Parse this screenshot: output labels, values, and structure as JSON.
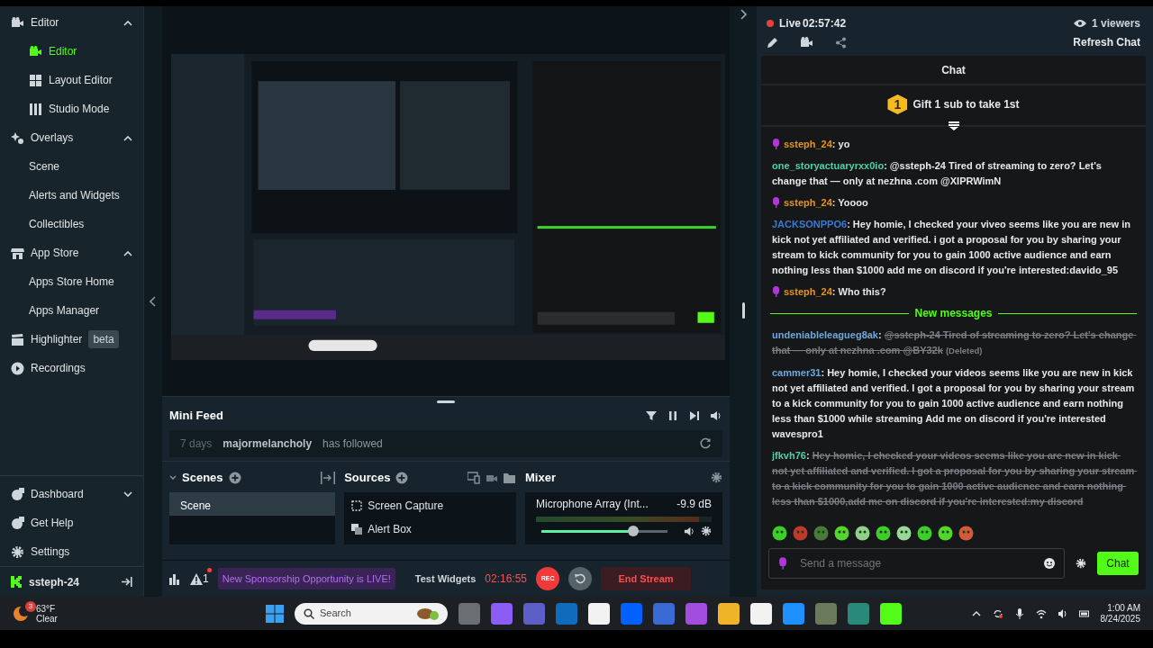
{
  "sidebar": {
    "sections": [
      {
        "label": "Editor",
        "expanded": true,
        "children": [
          {
            "label": "Editor",
            "selected": true
          },
          {
            "label": "Layout Editor",
            "selected": false
          },
          {
            "label": "Studio Mode",
            "selected": false
          }
        ]
      },
      {
        "label": "Overlays",
        "expanded": true,
        "children": [
          {
            "label": "Scene",
            "selected": false
          },
          {
            "label": "Alerts and Widgets",
            "selected": false
          },
          {
            "label": "Collectibles",
            "selected": false
          }
        ]
      },
      {
        "label": "App Store",
        "expanded": true,
        "children": [
          {
            "label": "Apps Store Home",
            "selected": false
          },
          {
            "label": "Apps Manager",
            "selected": false
          }
        ]
      },
      {
        "label": "Highlighter",
        "badge": "beta"
      },
      {
        "label": "Recordings"
      }
    ],
    "bottom": [
      {
        "label": "Dashboard",
        "expanded": false
      },
      {
        "label": "Get Help"
      },
      {
        "label": "Settings"
      }
    ],
    "user": {
      "name": "ssteph-24"
    }
  },
  "mini_feed": {
    "title": "Mini Feed",
    "events": [
      {
        "time": "7 days",
        "user": "majormelancholy",
        "action": "has followed"
      }
    ]
  },
  "scenes": {
    "title": "Scenes",
    "items": [
      {
        "label": "Scene",
        "selected": true
      }
    ]
  },
  "sources": {
    "title": "Sources",
    "items": [
      {
        "label": "Screen Capture"
      },
      {
        "label": "Alert Box"
      }
    ]
  },
  "mixer": {
    "title": "Mixer",
    "channels": [
      {
        "name": "Microphone Array (Int...",
        "reading": "-9.9 dB",
        "meter": {
          "level": 0.93
        },
        "level": 0.73
      }
    ]
  },
  "footer": {
    "alerts": "1",
    "sponsorship": "New Sponsorship Opportunity is LIVE!",
    "test_widgets": "Test Widgets",
    "timer": "02:16:55",
    "rec": "REC",
    "end_stream": "End Stream"
  },
  "stream": {
    "status": "Live",
    "time": "02:57:42",
    "viewers": "1 viewers",
    "refresh": "Refresh Chat"
  },
  "chat": {
    "title": "Chat",
    "leaderboard": {
      "rank": "1",
      "text": "Gift 1 sub to take 1st"
    },
    "messages": [
      {
        "user": "ssteph_24",
        "color": "#e8941c",
        "broadcaster": true,
        "text": ": yo",
        "deleted": false
      },
      {
        "user": "one_storyactuaryrxx0io",
        "color": "#4fd1a5",
        "broadcaster": false,
        "text": ": @ssteph-24 Tired of streaming to zero? Let's change that — only at nezhna .com @XIPRWimN",
        "deleted": false
      },
      {
        "user": "ssteph_24",
        "color": "#e8941c",
        "broadcaster": true,
        "text": ": Yoooo",
        "deleted": false
      },
      {
        "user": "JACKSONPPO6",
        "color": "#3a7bd5",
        "broadcaster": false,
        "text": ": Hey homie, I checked your viveo seems like you are new in kick not yet affiliated and verified. i got a proposal for you by sharing your stream to kick community for you to gain 1000 active audience and earn nothing less than $1000 add me on discord if you're interested:davido_95",
        "deleted": false
      },
      {
        "user": "ssteph_24",
        "color": "#e8941c",
        "broadcaster": true,
        "text": ": Who this?",
        "deleted": false
      },
      {
        "kind": "divider",
        "text": "New messages"
      },
      {
        "user": "undeniableleagueg8ak",
        "color": "#6fa8dc",
        "broadcaster": false,
        "separator": ": ",
        "text": "@ssteph-24 Tired of streaming to zero? Let's change that — only at nezhna .com @BY32k",
        "deleted": true,
        "note": "(Deleted)"
      },
      {
        "user": "cammer31",
        "color": "#6fa8dc",
        "broadcaster": false,
        "text": ": Hey homie, I checked your videos seems like you are new in kick not yet affiliated and verified. I got a proposal for you by sharing your stream to a kick community for you to gain 1000 active audience and earn nothing less than $1000 while streaming Add me on discord if you're interested wavespro1",
        "deleted": false
      },
      {
        "user": "jfkvh76",
        "color": "#4fd1a5",
        "broadcaster": false,
        "separator": ": ",
        "text": "Hey homie, I checked your videos seems like you are new in kick not yet affiliated and verified. I got a proposal for you by sharing your stream to a kick community for you to gain 1000 active audience and earn nothing less than $1000,add me on discord if you're interested:my discord",
        "deleted": true
      }
    ],
    "input": {
      "placeholder": "Send a message"
    },
    "send": "Chat"
  },
  "taskbar": {
    "weather": {
      "badge": "3",
      "temp": "63°F",
      "condition": "Clear"
    },
    "search": {
      "placeholder": "Search"
    },
    "time": "1:00 AM",
    "date": "8/24/2025"
  }
}
